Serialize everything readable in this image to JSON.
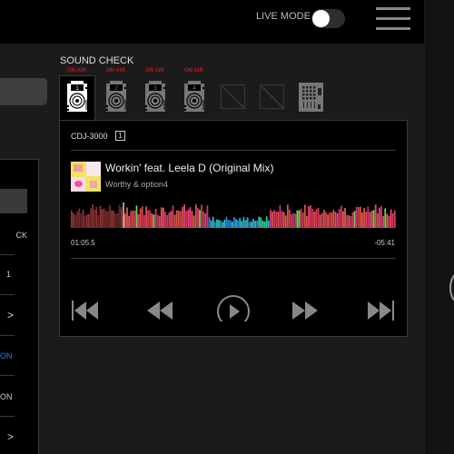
{
  "header": {
    "live_mode_label": "LIVE MODE",
    "live_mode_on": false,
    "menu_icon": "hamburger-menu-icon"
  },
  "sound_check": {
    "title": "SOUND CHECK",
    "decks": [
      {
        "number": "1",
        "status": "ON AIR",
        "selected": true,
        "type": "cdj"
      },
      {
        "number": "2",
        "status": "ON AIR",
        "selected": false,
        "type": "cdj"
      },
      {
        "number": "3",
        "status": "ON AIR",
        "selected": false,
        "type": "cdj"
      },
      {
        "number": "4",
        "status": "ON AIR",
        "selected": false,
        "type": "cdj"
      },
      {
        "type": "empty"
      },
      {
        "type": "empty"
      },
      {
        "type": "mixer"
      }
    ],
    "onair_color": "#c0161a"
  },
  "player": {
    "model": "CDJ-3000",
    "deck_number": "1",
    "track_title": "Workin' feat. Leela D (Original Mix)",
    "artist": "Worthy & option4",
    "elapsed": "01:05.5",
    "remaining": "-05:41",
    "playhead_fraction": 0.16,
    "controls": [
      "skip-back-icon",
      "rewind-icon",
      "play-icon",
      "fast-forward-icon",
      "skip-forward-icon"
    ]
  },
  "left_panel": {
    "rows": [
      "CK",
      "1",
      ">",
      "ON",
      "ON",
      ">"
    ],
    "active_row_color": "#1e88e5"
  }
}
